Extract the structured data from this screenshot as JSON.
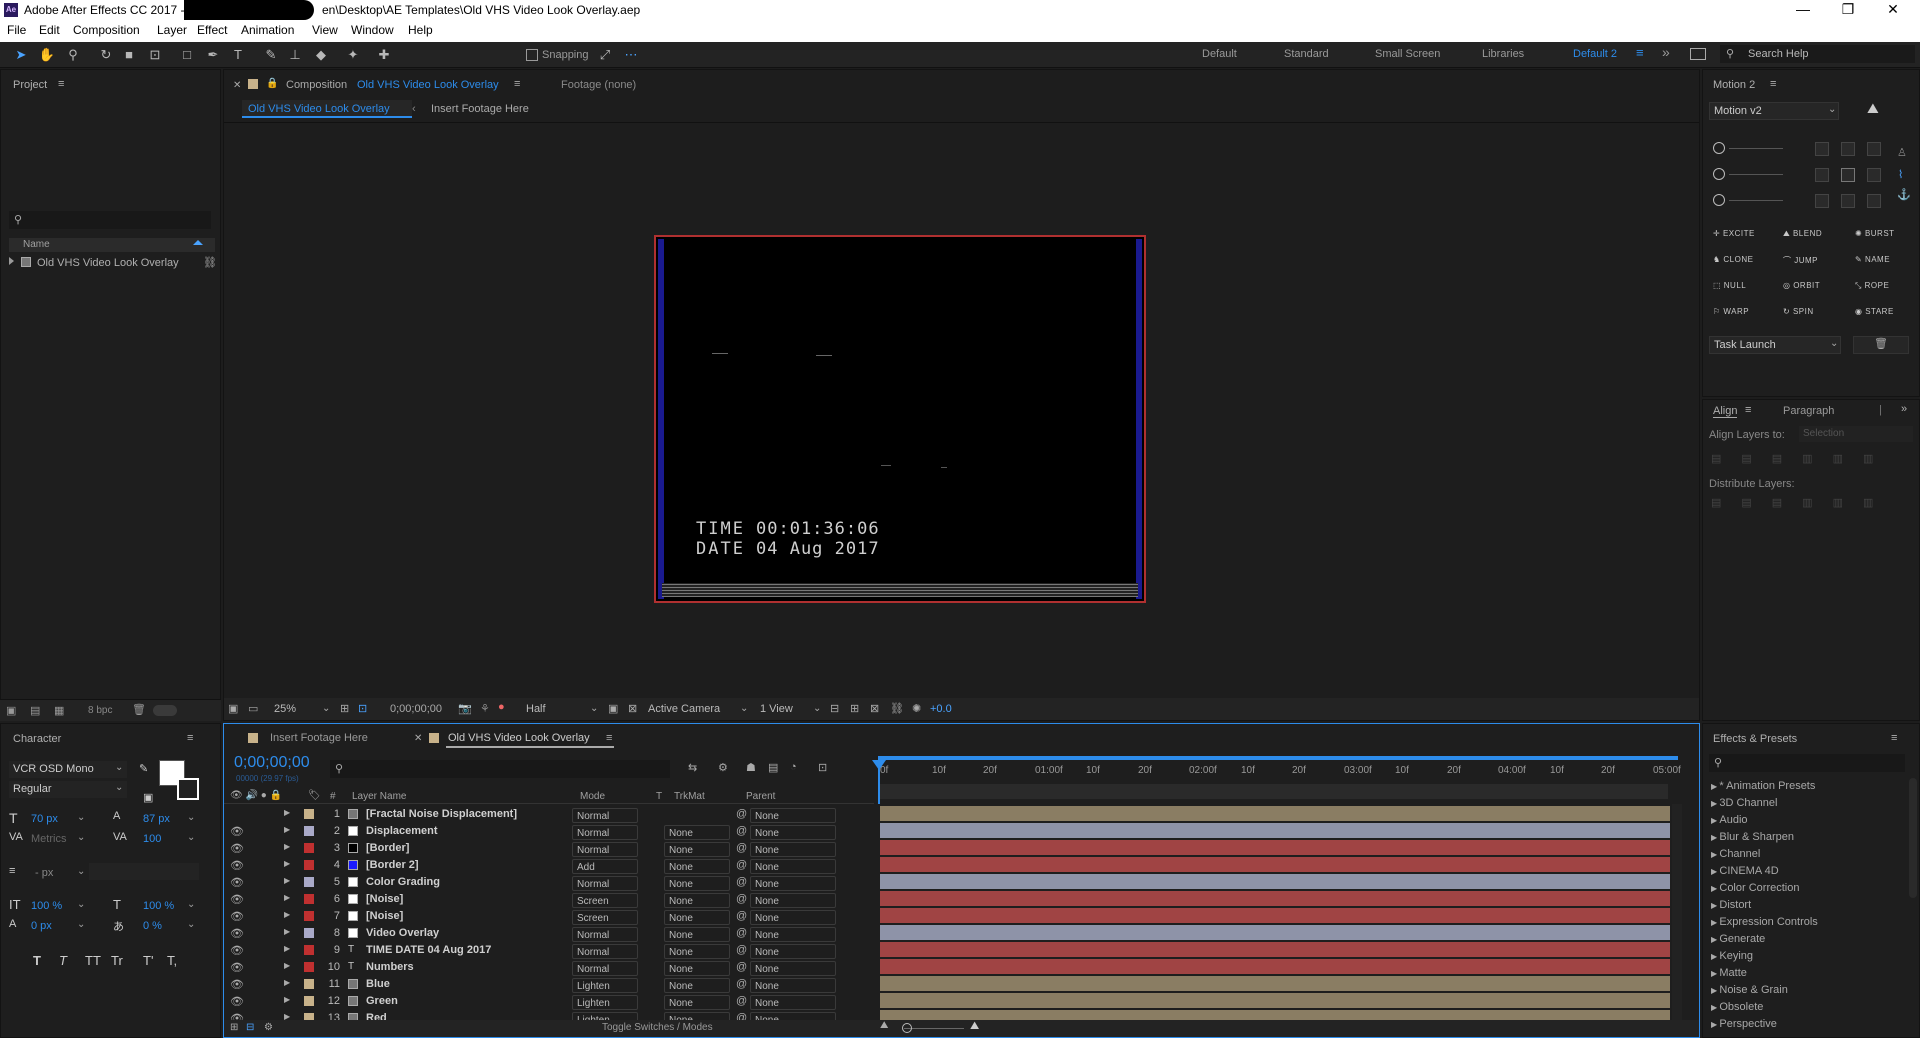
{
  "window": {
    "title_prefix": "Adobe After Effects CC 2017 - C",
    "title_suffix": "en\\Desktop\\AE Templates\\Old VHS Video Look Overlay.aep",
    "minimize": "—",
    "maximize": "❐",
    "close": "✕"
  },
  "menu": [
    "File",
    "Edit",
    "Composition",
    "Layer",
    "Effect",
    "Animation",
    "View",
    "Window",
    "Help"
  ],
  "toolbar": {
    "snapping": "Snapping",
    "workspaces": [
      "Default",
      "Standard",
      "Small Screen",
      "Libraries",
      "Default 2"
    ],
    "search_help": "Search Help"
  },
  "project": {
    "title": "Project",
    "search_placeholder": "",
    "column_name": "Name",
    "items": [
      "Old VHS Video Look Overlay"
    ],
    "bpc": "8 bpc"
  },
  "composition": {
    "tab_prefix": "Composition",
    "tab_name": "Old VHS Video Look Overlay",
    "footage": "Footage (none)",
    "breadcrumb_active": "Old VHS Video Look Overlay",
    "breadcrumb_other": "Insert Footage Here",
    "overlay_time_label": "TIME",
    "overlay_time_value": "00:01:36:06",
    "overlay_date_label": "DATE",
    "overlay_date_value": "04 Aug 2017",
    "zoom": "25%",
    "timecode": "0;00;00;00",
    "resolution": "Half",
    "camera": "Active Camera",
    "views": "1 View",
    "exposure": "+0.0"
  },
  "motion": {
    "title": "Motion 2",
    "preset": "Motion v2",
    "buttons": [
      "EXCITE",
      "BLEND",
      "BURST",
      "CLONE",
      "JUMP",
      "NAME",
      "NULL",
      "ORBIT",
      "ROPE",
      "WARP",
      "SPIN",
      "STARE"
    ],
    "task": "Task Launch"
  },
  "align": {
    "tab1": "Align",
    "tab2": "Paragraph",
    "align_to": "Align Layers to:",
    "align_to_value": "Selection",
    "distribute": "Distribute Layers:"
  },
  "character": {
    "title": "Character",
    "font": "VCR OSD Mono",
    "style": "Regular",
    "size": "70 px",
    "leading": "87 px",
    "kerning": "Metrics",
    "tracking": "100",
    "stroke": "- px",
    "vscale": "100 %",
    "hscale": "100 %",
    "baseline": "0 px",
    "tsume": "0 %",
    "styles": [
      "T",
      "T",
      "TT",
      "Tr",
      "T'",
      "T,"
    ]
  },
  "timeline": {
    "tab1": "Insert Footage Here",
    "tab2": "Old VHS Video Look Overlay",
    "timecode": "0;00;00;00",
    "fps": "00000 (29.97 fps)",
    "col_num": "#",
    "col_name": "Layer Name",
    "col_mode": "Mode",
    "col_t": "T",
    "col_trkmat": "TrkMat",
    "col_parent": "Parent",
    "ruler": [
      "0f",
      "10f",
      "20f",
      "01:00f",
      "10f",
      "20f",
      "02:00f",
      "10f",
      "20f",
      "03:00f",
      "10f",
      "20f",
      "04:00f",
      "10f",
      "20f",
      "05:00f"
    ],
    "toggle": "Toggle Switches / Modes",
    "layers": [
      {
        "num": "1",
        "name": "[Fractal Noise Displacement]",
        "mode": "Normal",
        "trkmat": "",
        "parent": "None",
        "label": "#c8b28a",
        "swatch": "#777",
        "icon": "comp",
        "bar": "#8a7d63"
      },
      {
        "num": "2",
        "name": "Displacement",
        "mode": "Normal",
        "trkmat": "None",
        "parent": "None",
        "label": "#a9a9c8",
        "swatch": "#fff",
        "icon": "solid",
        "bar": "#8e93a8"
      },
      {
        "num": "3",
        "name": "[Border]",
        "mode": "Normal",
        "trkmat": "None",
        "parent": "None",
        "label": "#c03030",
        "swatch": "#000",
        "icon": "solid",
        "bar": "#a04444"
      },
      {
        "num": "4",
        "name": "[Border 2]",
        "mode": "Add",
        "trkmat": "None",
        "parent": "None",
        "label": "#c03030",
        "swatch": "#1a1aff",
        "icon": "solid",
        "bar": "#a04444"
      },
      {
        "num": "5",
        "name": "Color Grading",
        "mode": "Normal",
        "trkmat": "None",
        "parent": "None",
        "label": "#a9a9c8",
        "swatch": "#fff",
        "icon": "solid",
        "bar": "#8e93a8"
      },
      {
        "num": "6",
        "name": "[Noise]",
        "mode": "Screen",
        "trkmat": "None",
        "parent": "None",
        "label": "#c03030",
        "swatch": "#fff",
        "icon": "solid",
        "bar": "#a04444"
      },
      {
        "num": "7",
        "name": "[Noise]",
        "mode": "Screen",
        "trkmat": "None",
        "parent": "None",
        "label": "#c03030",
        "swatch": "#fff",
        "icon": "solid",
        "bar": "#a04444"
      },
      {
        "num": "8",
        "name": "Video Overlay",
        "mode": "Normal",
        "trkmat": "None",
        "parent": "None",
        "label": "#a9a9c8",
        "swatch": "#fff",
        "icon": "solid",
        "bar": "#8e93a8"
      },
      {
        "num": "9",
        "name": "TIME DATE 04 Aug 2017",
        "mode": "Normal",
        "trkmat": "None",
        "parent": "None",
        "label": "#c03030",
        "swatch": "",
        "icon": "text",
        "bar": "#a04444"
      },
      {
        "num": "10",
        "name": "Numbers",
        "mode": "Normal",
        "trkmat": "None",
        "parent": "None",
        "label": "#c03030",
        "swatch": "",
        "icon": "text",
        "bar": "#a04444"
      },
      {
        "num": "11",
        "name": "Blue",
        "mode": "Lighten",
        "trkmat": "None",
        "parent": "None",
        "label": "#c8b28a",
        "swatch": "#777",
        "icon": "comp",
        "bar": "#8a7d63"
      },
      {
        "num": "12",
        "name": "Green",
        "mode": "Lighten",
        "trkmat": "None",
        "parent": "None",
        "label": "#c8b28a",
        "swatch": "#777",
        "icon": "comp",
        "bar": "#8a7d63"
      },
      {
        "num": "13",
        "name": "Red",
        "mode": "Lighten",
        "trkmat": "None",
        "parent": "None",
        "label": "#c8b28a",
        "swatch": "#777",
        "icon": "comp",
        "bar": "#8a7d63"
      }
    ]
  },
  "effects": {
    "title": "Effects & Presets",
    "items": [
      "* Animation Presets",
      "3D Channel",
      "Audio",
      "Blur & Sharpen",
      "Channel",
      "CINEMA 4D",
      "Color Correction",
      "Distort",
      "Expression Controls",
      "Generate",
      "Keying",
      "Matte",
      "Noise & Grain",
      "Obsolete",
      "Perspective"
    ]
  }
}
